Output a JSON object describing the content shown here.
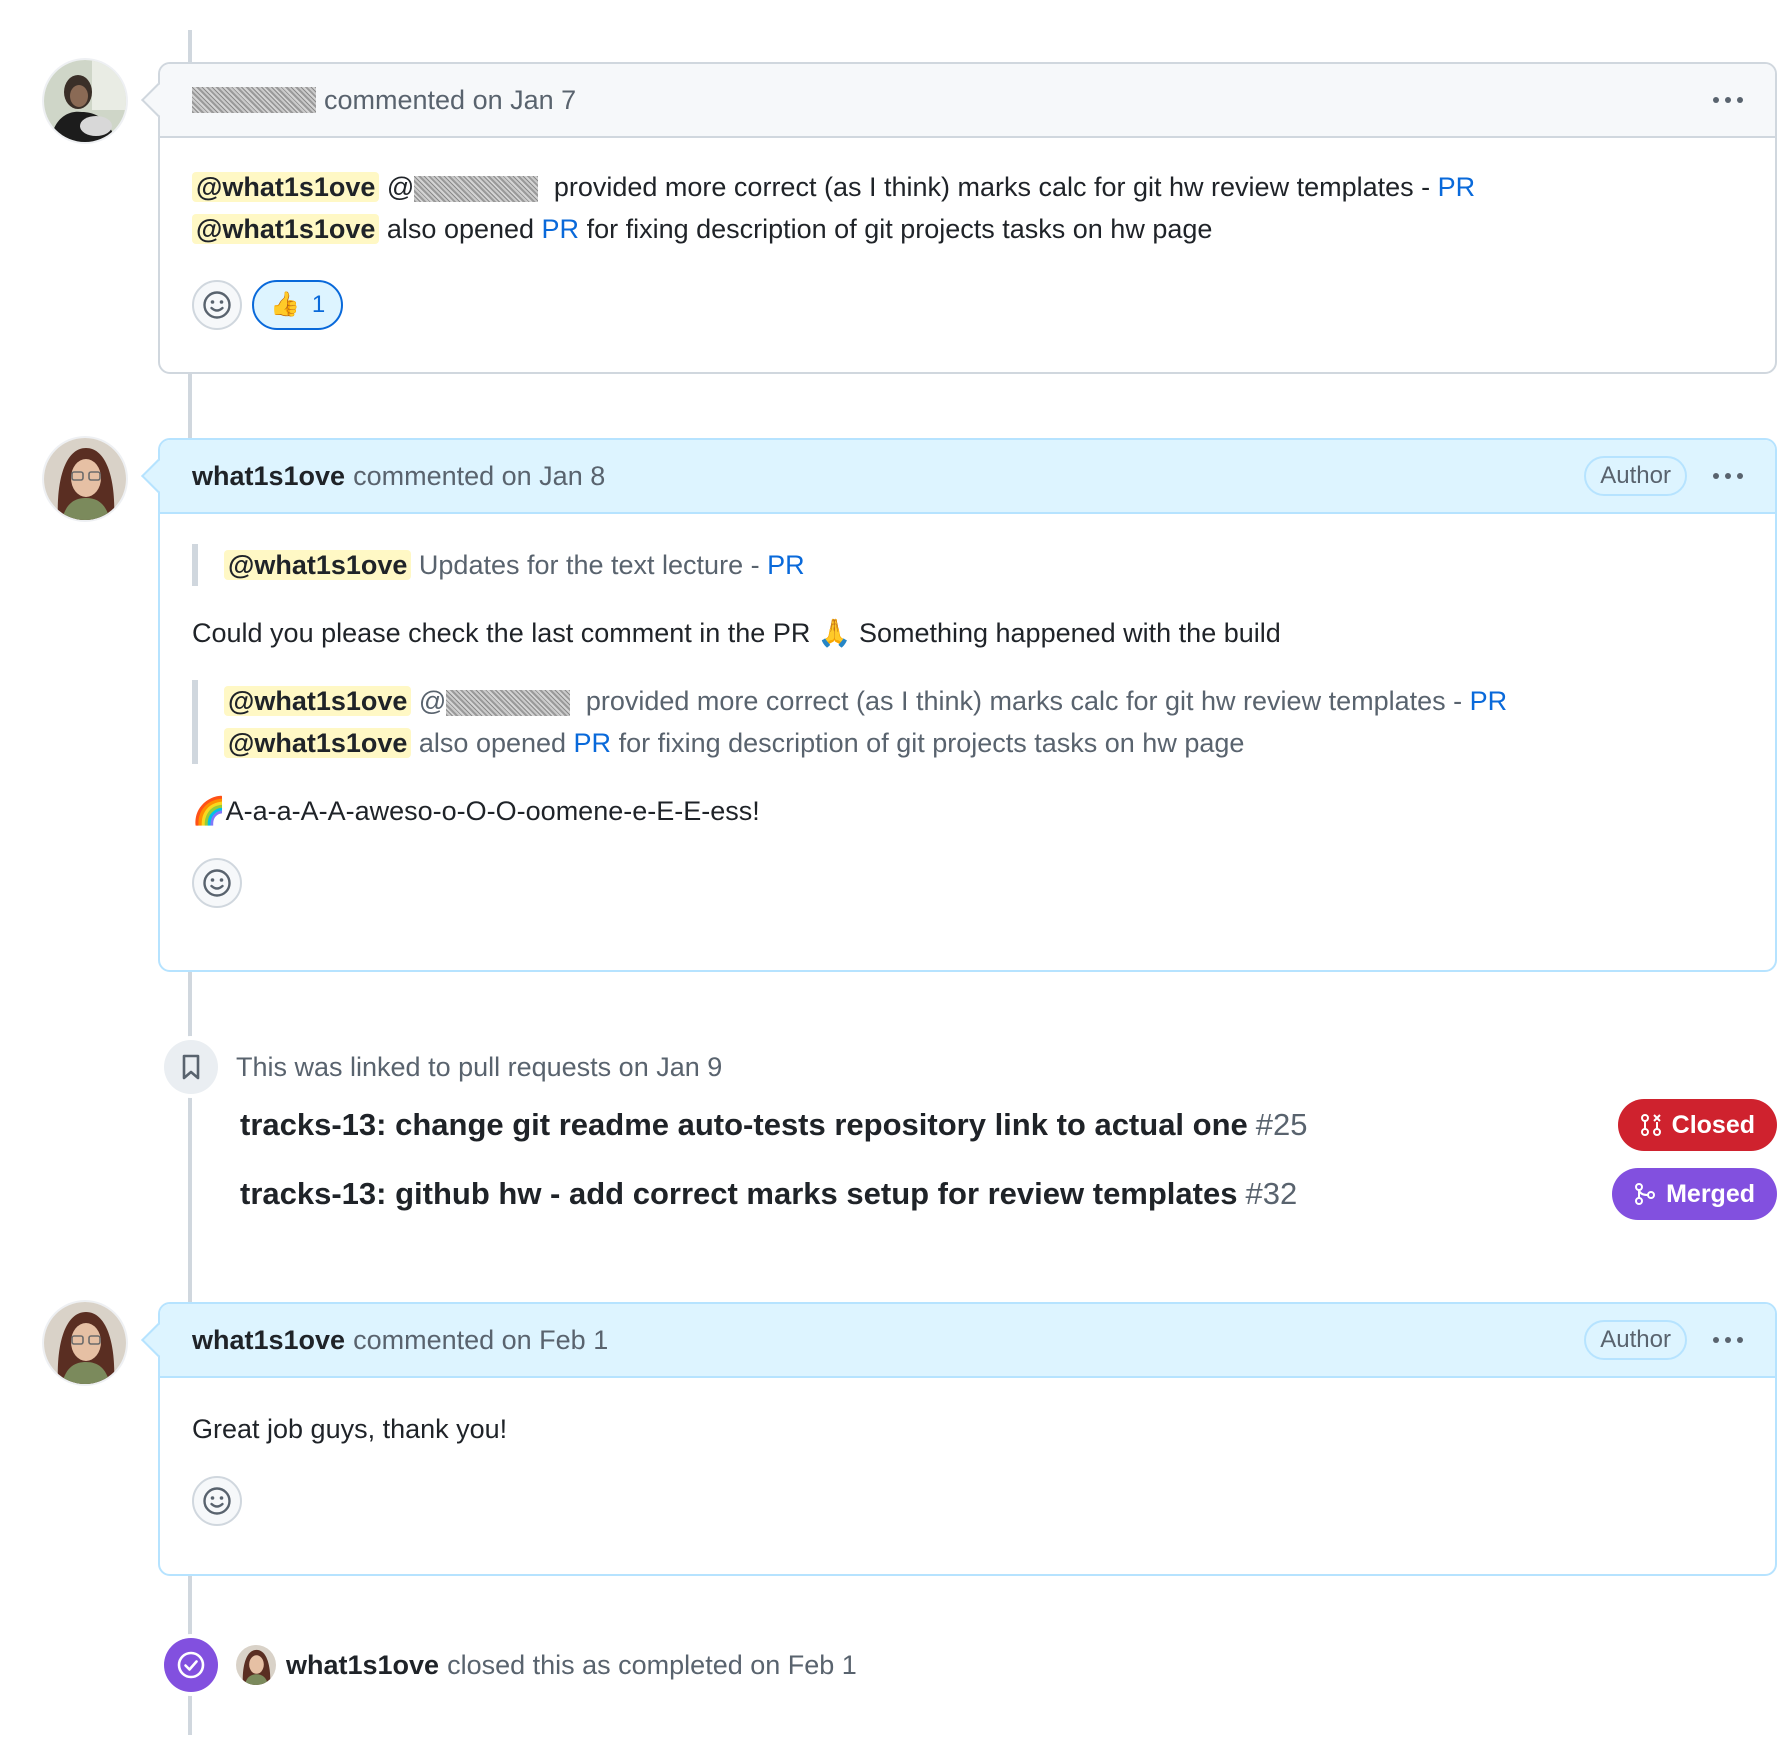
{
  "comments": [
    {
      "author": "",
      "action": "commented on Jan 7",
      "avatar_icon": "user-photo-avatar",
      "lines": {
        "l1_mention": "@what1s1ove",
        "l1_at": "@",
        "l1_text": " provided more correct (as I think) marks calc for git hw review templates - ",
        "l1_link": "PR",
        "l2_mention": "@what1s1ove",
        "l2_text1": " also opened ",
        "l2_link": "PR",
        "l2_text2": " for fixing description of git projects tasks on hw page"
      },
      "reaction": {
        "emoji": "👍",
        "count": "1"
      }
    },
    {
      "author": "what1s1ove",
      "action": "commented on Jan 8",
      "badge": "Author",
      "quote1": {
        "mention": "@what1s1ove",
        "text": " Updates for the text lecture - ",
        "link": "PR"
      },
      "para1": "Could you please check the last comment in the PR 🙏 Something happened with the build",
      "quote2": {
        "l1_mention": "@what1s1ove",
        "l1_at": "@",
        "l1_text": " provided more correct (as I think) marks calc for git hw review templates - ",
        "l1_link": "PR",
        "l2_mention": "@what1s1ove",
        "l2_text1": " also opened ",
        "l2_link": "PR",
        "l2_text2": " for fixing description of git projects tasks on hw page"
      },
      "para2": "🌈A-a-a-A-A-aweso-o-O-O-oomene-e-E-E-ess!"
    },
    {
      "author": "what1s1ove",
      "action": "commented on Feb 1",
      "badge": "Author",
      "body": "Great job guys, thank you!"
    }
  ],
  "linked_event": {
    "text": "This was linked to pull requests on Jan 9",
    "prs": [
      {
        "title": "tracks-13: change git readme auto-tests repository link to actual one",
        "number": "#25",
        "state": "Closed",
        "color": "#cf222e"
      },
      {
        "title": "tracks-13: github hw - add correct marks setup for review templates",
        "number": "#32",
        "state": "Merged",
        "color": "#8250df"
      }
    ]
  },
  "closed_event": {
    "user": "what1s1ove",
    "text": "closed this as completed on Feb 1",
    "color": "#8250df"
  },
  "colors": {
    "link": "#0969da",
    "mention_bg": "#fff8c5",
    "author_header": "#ddf4ff",
    "border": "#d0d7de"
  }
}
